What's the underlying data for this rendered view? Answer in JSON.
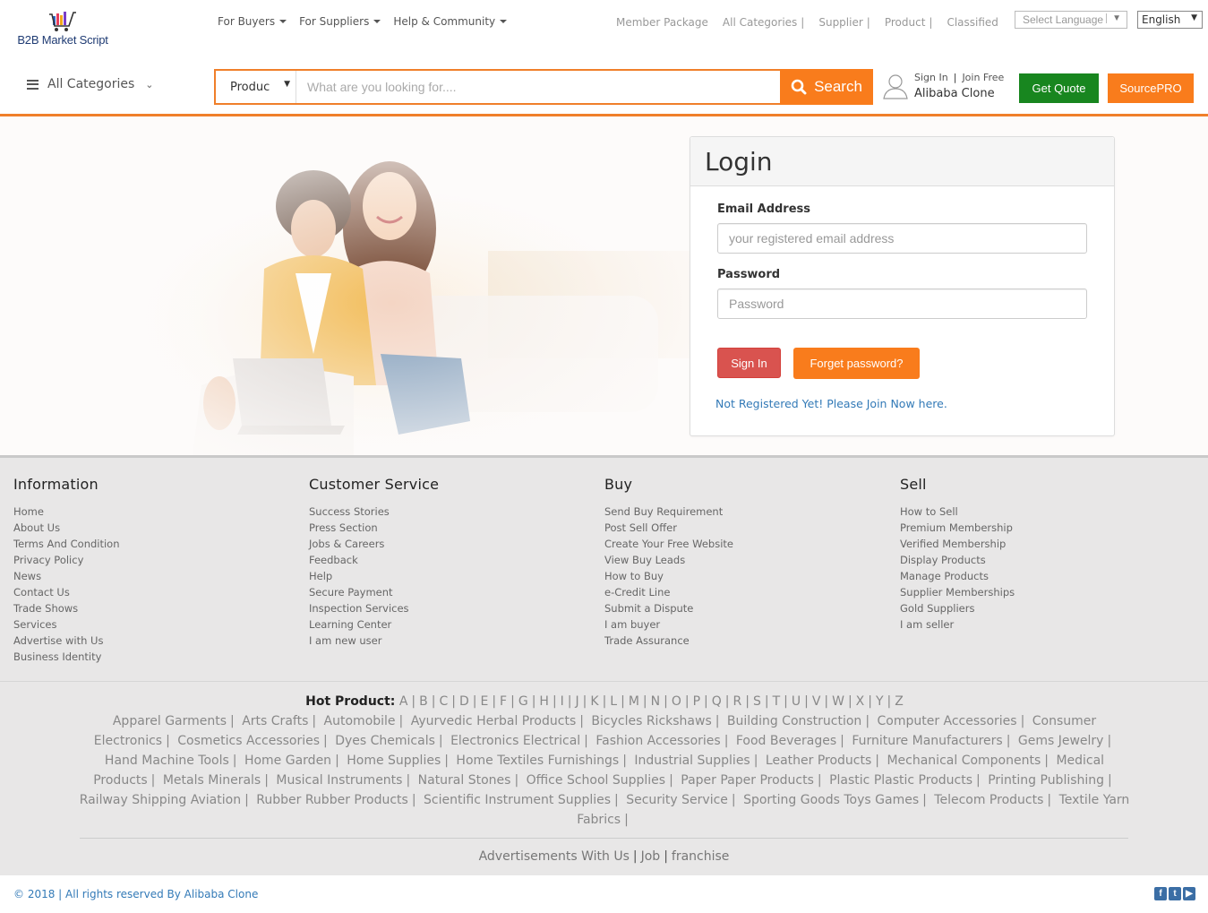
{
  "header": {
    "logo_text": "B2B Market Script",
    "topnav": [
      {
        "label": "For Buyers"
      },
      {
        "label": "For Suppliers"
      },
      {
        "label": "Help & Community"
      }
    ],
    "toplinks": [
      {
        "label": "Member Package",
        "sep": ""
      },
      {
        "label": "All Categories",
        "sep": "|"
      },
      {
        "label": "Supplier",
        "sep": "|"
      },
      {
        "label": "Product",
        "sep": "|"
      },
      {
        "label": "Classified",
        "sep": ""
      }
    ],
    "language_select": {
      "value": "Select Language",
      "arrow": "▼"
    },
    "english_select": {
      "value": "English",
      "arrow": "▼"
    },
    "all_categories": "All Categories",
    "search": {
      "type_value": "Produc",
      "type_arrow": "▼",
      "placeholder": "What are you looking for....",
      "value": "",
      "button_label": "Search"
    },
    "account": {
      "sign_in": "Sign In",
      "separator": "|",
      "join_free": "Join Free",
      "name": "Alibaba Clone"
    },
    "get_quote": "Get Quote",
    "source_pro": "SourcePRO",
    "accent_color": "#f07f2a",
    "green_color": "#18861f"
  },
  "login": {
    "title": "Login",
    "email_label": "Email Address",
    "email_placeholder": "your registered email address",
    "email_value": "",
    "password_label": "Password",
    "password_placeholder": "Password",
    "password_value": "",
    "sign_in_button": "Sign In",
    "forget_button": "Forget password?",
    "join_link": "Not Registered Yet! Please Join Now here."
  },
  "footer": {
    "columns": [
      {
        "title": "Information",
        "links": [
          "Home",
          "About Us",
          "Terms And Condition",
          "Privacy Policy",
          "News",
          "Contact Us",
          "Trade Shows",
          "Services",
          "Advertise with Us",
          "Business Identity"
        ]
      },
      {
        "title": "Customer Service",
        "links": [
          "Success Stories",
          "Press Section",
          "Jobs & Careers",
          "Feedback",
          "Help",
          "Secure Payment",
          "Inspection Services",
          "Learning Center",
          "I am new user"
        ]
      },
      {
        "title": "Buy",
        "links": [
          "Send Buy Requirement",
          "Post Sell Offer",
          "Create Your Free Website",
          "View Buy Leads",
          "How to Buy",
          "e-Credit Line",
          "Submit a Dispute",
          "I am buyer",
          "Trade Assurance"
        ]
      },
      {
        "title": "Sell",
        "links": [
          "How to Sell",
          "Premium Membership",
          "Verified Membership",
          "Display Products",
          "Manage Products",
          "Supplier Memberships",
          "Gold Suppliers",
          "I am seller"
        ]
      }
    ],
    "hot_product_title": "Hot Product:",
    "letters": [
      "A",
      "B",
      "C",
      "D",
      "E",
      "F",
      "G",
      "H",
      "I",
      "J",
      "K",
      "L",
      "M",
      "N",
      "O",
      "P",
      "Q",
      "R",
      "S",
      "T",
      "U",
      "V",
      "W",
      "X",
      "Y",
      "Z"
    ],
    "categories": [
      "Apparel Garments",
      "Arts Crafts",
      "Automobile",
      "Ayurvedic Herbal Products",
      "Bicycles Rickshaws",
      "Building Construction",
      "Computer Accessories",
      "Consumer Electronics",
      "Cosmetics Accessories",
      "Dyes Chemicals",
      "Electronics Electrical",
      "Fashion Accessories",
      "Food Beverages",
      "Furniture Manufacturers",
      "Gems Jewelry",
      "Hand Machine Tools",
      "Home Garden",
      "Home Supplies",
      "Home Textiles Furnishings",
      "Industrial Supplies",
      "Leather Products",
      "Mechanical Components",
      "Medical Products",
      "Metals Minerals",
      "Musical Instruments",
      "Natural Stones",
      "Office School Supplies",
      "Paper Paper Products",
      "Plastic Plastic Products",
      "Printing Publishing",
      "Railway Shipping Aviation",
      "Rubber Rubber Products",
      "Scientific Instrument Supplies",
      "Security Service",
      "Sporting Goods Toys Games",
      "Telecom Products",
      "Textile Yarn Fabrics"
    ],
    "bottom_links": [
      "Advertisements With Us",
      "Job",
      "franchise"
    ],
    "copyright": "© 2018 | All rights reserved By Alibaba Clone",
    "social": [
      {
        "name": "facebook-icon",
        "glyph": "f"
      },
      {
        "name": "twitter-icon",
        "glyph": "t"
      },
      {
        "name": "youtube-icon",
        "glyph": "▶"
      }
    ]
  }
}
